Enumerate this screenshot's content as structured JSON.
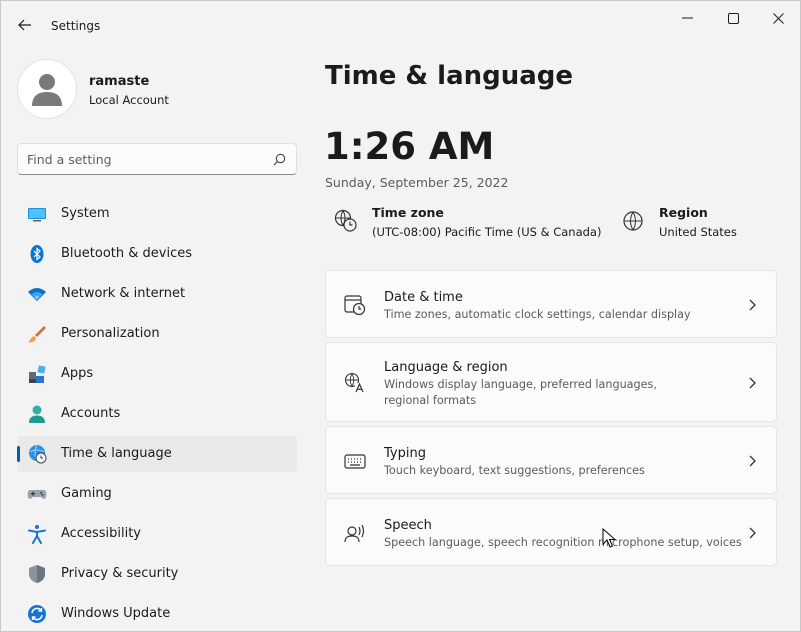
{
  "window": {
    "title": "Settings",
    "controls": {
      "minimize": "minimize-icon",
      "maximize": "maximize-icon",
      "close": "close-icon"
    }
  },
  "user": {
    "name": "ramaste",
    "account_type": "Local Account"
  },
  "search": {
    "placeholder": "Find a setting",
    "value": ""
  },
  "nav": {
    "items": [
      {
        "label": "System",
        "icon": "system-icon"
      },
      {
        "label": "Bluetooth & devices",
        "icon": "bluetooth-icon"
      },
      {
        "label": "Network & internet",
        "icon": "wifi-icon"
      },
      {
        "label": "Personalization",
        "icon": "brush-icon"
      },
      {
        "label": "Apps",
        "icon": "apps-icon"
      },
      {
        "label": "Accounts",
        "icon": "accounts-icon"
      },
      {
        "label": "Time & language",
        "icon": "globe-clock-icon",
        "selected": true
      },
      {
        "label": "Gaming",
        "icon": "gamepad-icon"
      },
      {
        "label": "Accessibility",
        "icon": "accessibility-icon"
      },
      {
        "label": "Privacy & security",
        "icon": "shield-icon"
      },
      {
        "label": "Windows Update",
        "icon": "update-icon"
      }
    ]
  },
  "main": {
    "title": "Time & language",
    "time": "1:26 AM",
    "date": "Sunday, September 25, 2022",
    "timezone": {
      "title": "Time zone",
      "value": "(UTC-08:00) Pacific Time (US & Canada)"
    },
    "region": {
      "title": "Region",
      "value": "United States"
    },
    "cards": [
      {
        "title": "Date & time",
        "description": "Time zones, automatic clock settings, calendar display",
        "icon": "calendar-clock-icon"
      },
      {
        "title": "Language & region",
        "description": "Windows display language, preferred languages, regional formats",
        "icon": "language-icon"
      },
      {
        "title": "Typing",
        "description": "Touch keyboard, text suggestions, preferences",
        "icon": "keyboard-icon"
      },
      {
        "title": "Speech",
        "description": "Speech language, speech recognition microphone setup, voices",
        "icon": "speech-icon"
      }
    ]
  },
  "colors": {
    "accent": "#005fb8",
    "background": "#f3f3f3",
    "card": "#fbfbfb",
    "selected": "#e9e9e9"
  }
}
